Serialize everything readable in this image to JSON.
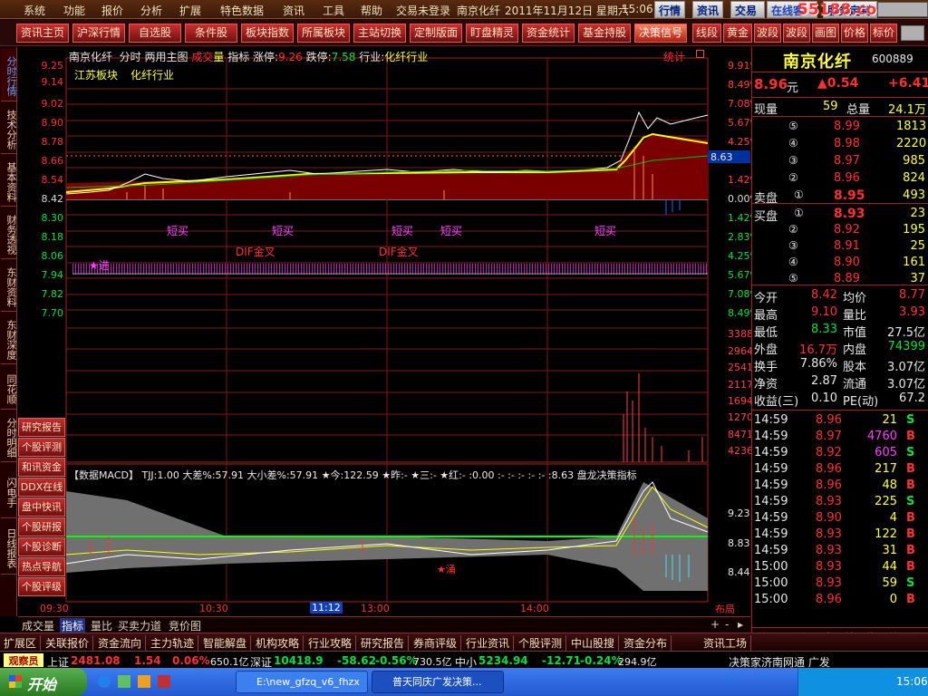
{
  "menu": {
    "items": [
      "系统",
      "功能",
      "报价",
      "分析",
      "扩展",
      "特色数据",
      "资讯",
      "工具",
      "帮助",
      "交易未登录"
    ],
    "title": "南京化纤",
    "date": "2011年11月12日 星期六",
    "time": "15:06",
    "tabs": [
      "行情",
      "资讯",
      "交易"
    ],
    "extra": [
      "在线客服",
      "服务定制"
    ],
    "site": "55188.com"
  },
  "toolbar": [
    "资讯主页",
    "沪深行情",
    "自选股",
    "条件股",
    "板块指数",
    "所属板块",
    "主站切换",
    "定制版面",
    "盯盘精灵",
    "资金统计",
    "基金持股",
    "决策信号",
    "线段",
    "黄金",
    "波段",
    "波段",
    "画图",
    "价格",
    "标价"
  ],
  "lefttabs": [
    "分时行情",
    "技术分析",
    "基本资料",
    "财务透视",
    "东财资料",
    "东财深度",
    "同花顺",
    "分时明细",
    "闪电手",
    "日线报表"
  ],
  "sidemenu": [
    "研究报告",
    "个股评测",
    "和讯资金",
    "DDX在线",
    "盘中快讯",
    "个股研报",
    "个股诊断",
    "热点导航",
    "个股评级"
  ],
  "chart": {
    "header": {
      "name": "南京化纤",
      "mode": "分时",
      "main": "两用主图",
      "vol": "成交",
      "volc": "量",
      "ind": "指标",
      "up_lbl": "涨停:",
      "up": "9.26",
      "dn_lbl": "跌停:",
      "dn": "7.58",
      "industry_lbl": "行业:",
      "industry": "化纤行业",
      "stat": "统计"
    },
    "sector": "江苏板块",
    "sector2": "化纤行业",
    "price_axis": [
      "9.25",
      "9.14",
      "9.02",
      "8.90",
      "8.78",
      "8.66",
      "8.54",
      "8.42",
      "8.30",
      "8.18",
      "8.06",
      "7.94",
      "7.82",
      "7.70"
    ],
    "pct_axis": [
      "9.91%",
      "8.49%",
      "7.08%",
      "5.67%",
      "4.25%",
      "2.83%",
      "1.42%",
      "0.00%",
      "1.42%",
      "2.83%",
      "4.25%",
      "5.67%",
      "7.08%",
      "8.49%"
    ],
    "cur_price": "8.63",
    "vol_axis": [
      "33884",
      "29649",
      "25413",
      "21178",
      "16942",
      "12707",
      "8471",
      "4236"
    ],
    "macd_header": "【数据MACD】 TJJ:1.00 大差%:57.91 大小差%:57.91 ★今:122.59 ★昨:- ★三:- ★红:- :0.00 :- :- :- :- :- :8.63 盘龙决策指标",
    "macd_axis": [
      "9.23",
      "8.83",
      "8.44"
    ],
    "signals": {
      "short": "短买",
      "dif": "DIF金叉",
      "star": "★进",
      "star2": "★涌"
    },
    "time_axis": [
      "09:30",
      "10:30",
      "11:12",
      "13:00",
      "14:00"
    ],
    "layout": "布局"
  },
  "btabs": [
    "成交量",
    "指标",
    "量比",
    "买卖力道",
    "竞价图"
  ],
  "stock": {
    "name": "南京化纤",
    "code": "600889",
    "price": "8.96",
    "unit": "元",
    "change": "▲0.54",
    "pct": "+6.41",
    "xianliang_lbl": "现量",
    "xianliang": "59",
    "zongliang_lbl": "总量",
    "zongliang": "24.1万",
    "sell": [
      {
        "n": "⑤",
        "p": "8.99",
        "v": "1813"
      },
      {
        "n": "④",
        "p": "8.98",
        "v": "2220"
      },
      {
        "n": "③",
        "p": "8.97",
        "v": "985"
      },
      {
        "n": "②",
        "p": "8.96",
        "v": "824"
      },
      {
        "n": "①",
        "p": "8.95",
        "v": "493"
      }
    ],
    "sell_lbl": "卖盘",
    "buy_lbl": "买盘",
    "buy": [
      {
        "n": "①",
        "p": "8.93",
        "v": "23"
      },
      {
        "n": "②",
        "p": "8.92",
        "v": "195"
      },
      {
        "n": "③",
        "p": "8.91",
        "v": "25"
      },
      {
        "n": "④",
        "p": "8.90",
        "v": "161"
      },
      {
        "n": "⑤",
        "p": "8.89",
        "v": "37"
      }
    ],
    "stats": [
      [
        "今开",
        "8.42",
        "均价",
        "8.77"
      ],
      [
        "最高",
        "9.10",
        "量比",
        "3.93"
      ],
      [
        "最低",
        "8.33",
        "市值",
        "27.5亿"
      ],
      [
        "外盘",
        "16.7万",
        "内盘",
        "74399"
      ],
      [
        "换手",
        "7.86%",
        "股本",
        "3.07亿"
      ],
      [
        "净资",
        "2.87",
        "流通",
        "3.07亿"
      ],
      [
        "收益(三)",
        "0.10",
        "PE(动)",
        "67.2"
      ]
    ],
    "ticks": [
      [
        "14:59",
        "8.96",
        "21",
        "S"
      ],
      [
        "14:59",
        "8.97",
        "4760",
        "B"
      ],
      [
        "14:59",
        "8.92",
        "605",
        "S"
      ],
      [
        "14:59",
        "8.96",
        "217",
        "B"
      ],
      [
        "14:59",
        "8.96",
        "48",
        "B"
      ],
      [
        "14:59",
        "8.93",
        "225",
        "S"
      ],
      [
        "14:59",
        "8.90",
        "4",
        "B"
      ],
      [
        "14:59",
        "8.93",
        "122",
        "B"
      ],
      [
        "14:59",
        "8.93",
        "31",
        "B"
      ],
      [
        "15:00",
        "8.93",
        "44",
        "B"
      ],
      [
        "15:00",
        "8.93",
        "59",
        "S"
      ],
      [
        "15:00",
        "8.96",
        "0",
        "B"
      ]
    ],
    "rtabs": [
      "笔",
      "价",
      "细",
      "盘",
      "势",
      "指",
      "值",
      "主"
    ]
  },
  "bottombar": [
    "扩展区",
    "关联报价",
    "资金流向",
    "主力轨迹",
    "智能解盘",
    "机构攻略",
    "行业攻略",
    "研究报告",
    "券商评级",
    "行业资讯",
    "个股评测",
    "中山股搜",
    "资金分布",
    "资讯工场"
  ],
  "ticker": {
    "label": "观察员",
    "items": [
      [
        "上证",
        "2481.08",
        "1.54",
        "0.06%",
        "650.1亿"
      ],
      [
        "深证",
        "10418.9",
        "-58.62",
        "-0.56%",
        "730.5亿"
      ],
      [
        "中小",
        "5234.94",
        "-12.71",
        "-0.24%",
        "294.9亿"
      ]
    ],
    "news": "决策家济南网通 广发"
  },
  "taskbar": {
    "start": "开始",
    "tasks": [
      "E:\\new_gfzq_v6_fhzx",
      "普天同庆广发决策..."
    ],
    "time": "15:06"
  }
}
